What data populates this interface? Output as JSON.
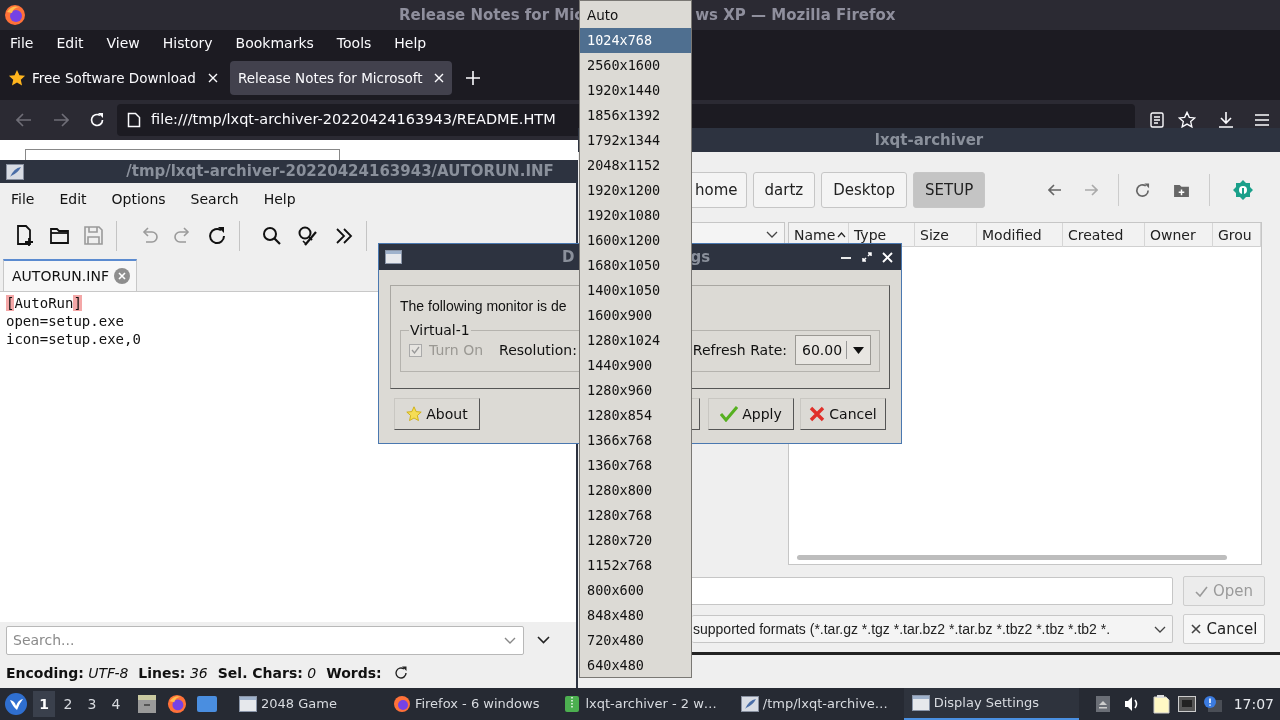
{
  "firefox": {
    "title_left": "Release Notes for Mic",
    "title_right": "ws XP — Mozilla Firefox",
    "menu": [
      "File",
      "Edit",
      "View",
      "History",
      "Bookmarks",
      "Tools",
      "Help"
    ],
    "tabs": [
      {
        "label": "Free Software Download",
        "selected": false,
        "kind": "starred"
      },
      {
        "label": "Release Notes for Microsoft",
        "selected": true,
        "kind": "plain"
      }
    ],
    "url": "file:///tmp/lxqt-archiver-20220424163943/README.HTM"
  },
  "editor": {
    "title": "/tmp/lxqt-archiver-20220424163943/AUTORUN.INF",
    "menu": [
      "File",
      "Edit",
      "Options",
      "Search",
      "Help"
    ],
    "toolbar": [
      {
        "kind": "new",
        "disabled": false
      },
      {
        "kind": "open",
        "disabled": false
      },
      {
        "kind": "save",
        "disabled": true
      },
      {
        "kind": "undo",
        "disabled": true
      },
      {
        "kind": "redo",
        "disabled": true
      },
      {
        "kind": "reload",
        "disabled": false
      },
      {
        "kind": "find",
        "disabled": false
      },
      {
        "kind": "replace",
        "disabled": false
      },
      {
        "kind": "more",
        "disabled": false
      }
    ],
    "tab": "AUTORUN.INF",
    "lines": [
      {
        "text": "[AutoRun]",
        "bracket_match": true
      },
      {
        "text": "open=setup.exe",
        "bracket_match": false
      },
      {
        "text": "icon=setup.exe,0",
        "bracket_match": false
      }
    ],
    "search": {
      "placeholder": "Search..."
    },
    "status": [
      {
        "label": "Encoding:",
        "value": "UTF-8"
      },
      {
        "label": "Lines:",
        "value": "36"
      },
      {
        "label": "Sel. Chars:",
        "value": "0"
      },
      {
        "label": "Words:"
      }
    ]
  },
  "archiver": {
    "title": "lxqt-archiver",
    "path": [
      {
        "label": "home",
        "selected": false
      },
      {
        "label": "dartz",
        "selected": false
      },
      {
        "label": "Desktop",
        "selected": false
      },
      {
        "label": "SETUP",
        "selected": true
      }
    ],
    "columns": [
      {
        "label": "Name",
        "sorted": true
      },
      {
        "label": "Type",
        "sorted": false
      },
      {
        "label": "Size",
        "sorted": false
      },
      {
        "label": "Modified",
        "sorted": false
      },
      {
        "label": "Created",
        "sorted": false
      },
      {
        "label": "Owner",
        "sorted": false
      },
      {
        "label": "Grou",
        "sorted": false
      }
    ],
    "open_button": {
      "label": "Open",
      "disabled": true
    },
    "filter": "supported formats (*.tar.gz *.tgz *.tar.bz2 *.tar.bz *.tbz2 *.tbz *.tb2 *.",
    "cancel_button": "Cancel"
  },
  "dialog": {
    "title_left": "D",
    "title_right": "gs",
    "message": "The following monitor is de",
    "group": "Virtual-1",
    "turn_on": {
      "label": "Turn On",
      "checked": true,
      "disabled": true
    },
    "resolution_label": "Resolution:",
    "refresh_label": "Refresh Rate:",
    "refresh_value": "60.00",
    "about_button": "About",
    "apply_button": "Apply",
    "cancel_button": "Cancel"
  },
  "dropdown": {
    "items": [
      {
        "label": "Auto",
        "selected": false
      },
      {
        "label": "1024x768",
        "selected": true
      },
      {
        "label": "2560x1600",
        "selected": false
      },
      {
        "label": "1920x1440",
        "selected": false
      },
      {
        "label": "1856x1392",
        "selected": false
      },
      {
        "label": "1792x1344",
        "selected": false
      },
      {
        "label": "2048x1152",
        "selected": false
      },
      {
        "label": "1920x1200",
        "selected": false
      },
      {
        "label": "1920x1080",
        "selected": false
      },
      {
        "label": "1600x1200",
        "selected": false
      },
      {
        "label": "1680x1050",
        "selected": false
      },
      {
        "label": "1400x1050",
        "selected": false
      },
      {
        "label": "1600x900",
        "selected": false
      },
      {
        "label": "1280x1024",
        "selected": false
      },
      {
        "label": "1440x900",
        "selected": false
      },
      {
        "label": "1280x960",
        "selected": false
      },
      {
        "label": "1280x854",
        "selected": false
      },
      {
        "label": "1366x768",
        "selected": false
      },
      {
        "label": "1360x768",
        "selected": false
      },
      {
        "label": "1280x800",
        "selected": false
      },
      {
        "label": "1280x768",
        "selected": false
      },
      {
        "label": "1280x720",
        "selected": false
      },
      {
        "label": "1152x768",
        "selected": false
      },
      {
        "label": "800x600",
        "selected": false
      },
      {
        "label": "848x480",
        "selected": false
      },
      {
        "label": "720x480",
        "selected": false
      },
      {
        "label": "640x480",
        "selected": false
      }
    ]
  },
  "taskbar": {
    "desktops": [
      {
        "label": "1",
        "selected": true
      },
      {
        "label": "2",
        "selected": false
      },
      {
        "label": "3",
        "selected": false
      },
      {
        "label": "4",
        "selected": false
      }
    ],
    "tasks": [
      {
        "label": "2048 Game",
        "kind": "window",
        "selected": false
      },
      {
        "label": "Firefox - 6 windows",
        "kind": "firefox",
        "selected": false
      },
      {
        "label": "lxqt-archiver - 2 w…",
        "kind": "archive",
        "selected": false
      },
      {
        "label": "/tmp/lxqt-archive…",
        "kind": "editor",
        "selected": false
      },
      {
        "label": "Display Settings",
        "kind": "window",
        "selected": true
      }
    ],
    "clock": "17:07"
  }
}
